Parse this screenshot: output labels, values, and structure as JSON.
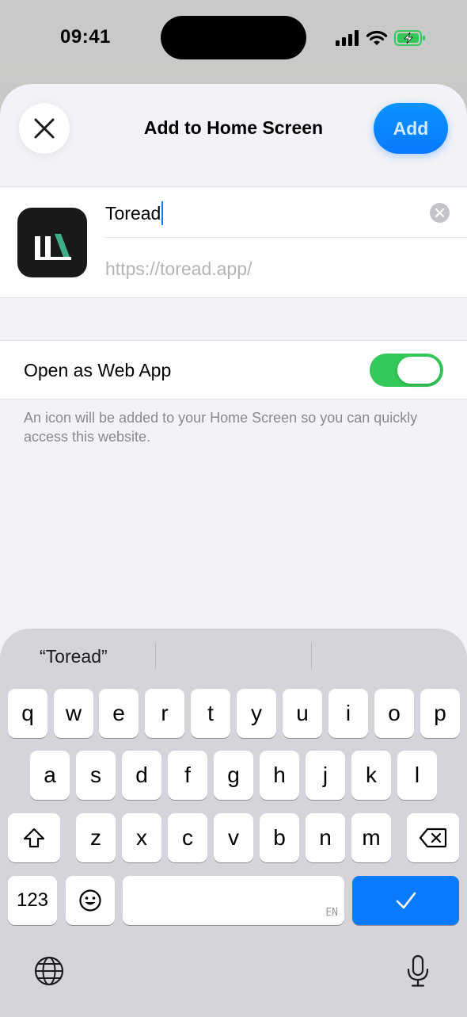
{
  "status_bar": {
    "time": "09:41",
    "icons": [
      "cellular-signal-icon",
      "wifi-icon",
      "battery-charging-icon"
    ],
    "battery_color": "#34c759"
  },
  "sheet": {
    "title": "Add to Home Screen",
    "close_icon": "close-icon",
    "add_label": "Add",
    "accent_color": "#0a7aff"
  },
  "bookmark": {
    "name_value": "Toread",
    "url_value": "https://toread.app/",
    "app_icon": "toread-app-icon"
  },
  "web_app": {
    "label": "Open as Web App",
    "enabled": true,
    "toggle_color": "#34c759"
  },
  "footnote": "An icon will be added to your Home Screen so you can quickly access this website.",
  "keyboard": {
    "prediction": "“Toread”",
    "rows": [
      [
        "q",
        "w",
        "e",
        "r",
        "t",
        "y",
        "u",
        "i",
        "o",
        "p"
      ],
      [
        "a",
        "s",
        "d",
        "f",
        "g",
        "h",
        "j",
        "k",
        "l"
      ],
      [
        "z",
        "x",
        "c",
        "v",
        "b",
        "n",
        "m"
      ]
    ],
    "numbers_label": "123",
    "space_hint": "EN",
    "shift_icon": "shift-icon",
    "delete_icon": "backspace-icon",
    "emoji_icon": "emoji-icon",
    "done_icon": "checkmark-icon",
    "globe_icon": "globe-icon",
    "mic_icon": "microphone-icon"
  }
}
